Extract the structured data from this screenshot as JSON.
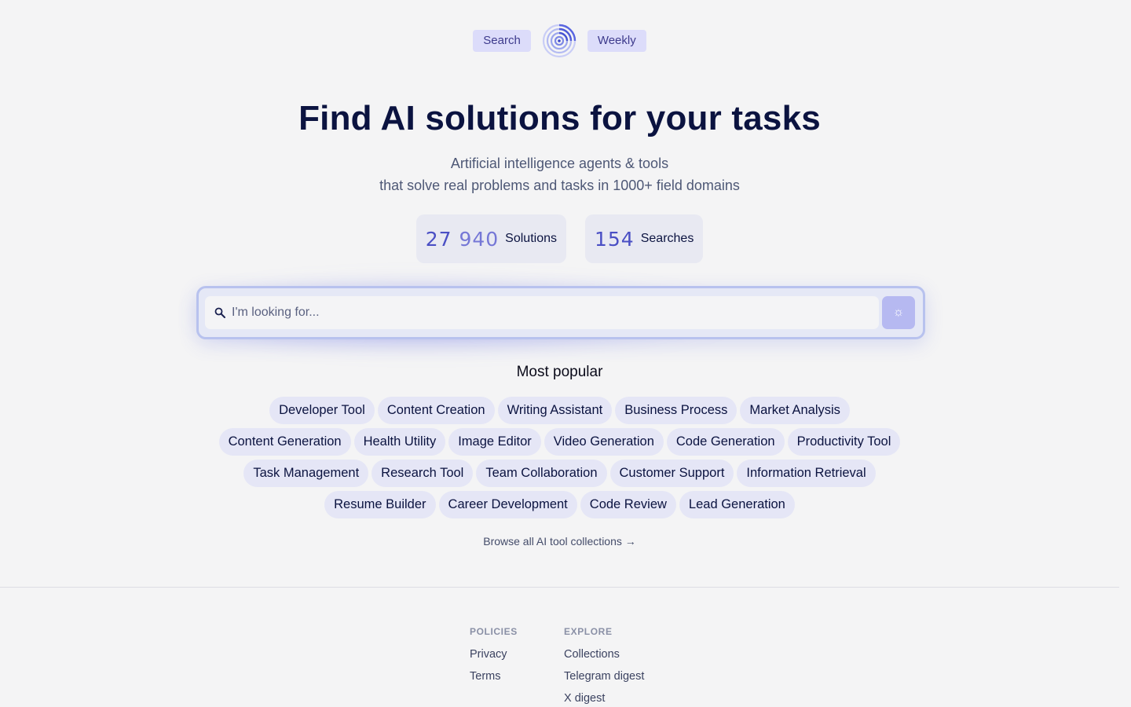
{
  "nav": {
    "left_label": "Search",
    "right_label": "Weekly",
    "logo_icon": "spiral-logo-icon"
  },
  "hero": {
    "title": "Find AI solutions for your tasks",
    "subtitle_line1": "Artificial intelligence agents & tools",
    "subtitle_line2": "that solve real problems and tasks in 1000+ field domains"
  },
  "stats": {
    "solutions_prefix": "27",
    "solutions_suffix": "940",
    "solutions_label": "Solutions",
    "searches_value": "154",
    "searches_label": "Searches"
  },
  "search": {
    "placeholder": "I'm looking for...",
    "value": "",
    "search_icon": "search-icon",
    "submit_icon": "sparkle-icon",
    "submit_glyph": "☼"
  },
  "popular": {
    "title": "Most popular",
    "tags": [
      "Developer Tool",
      "Content Creation",
      "Writing Assistant",
      "Business Process",
      "Market Analysis",
      "Content Generation",
      "Health Utility",
      "Image Editor",
      "Video Generation",
      "Code Generation",
      "Productivity Tool",
      "Task Management",
      "Research Tool",
      "Team Collaboration",
      "Customer Support",
      "Information Retrieval",
      "Resume Builder",
      "Career Development",
      "Code Review",
      "Lead Generation"
    ],
    "browse_label": "Browse all AI tool collections →"
  },
  "footer": {
    "policies_heading": "POLICIES",
    "policies_links": [
      "Privacy",
      "Terms"
    ],
    "explore_heading": "EXPLORE",
    "explore_links": [
      "Collections",
      "Telegram digest",
      "X digest"
    ]
  },
  "colors": {
    "accent": "#4a4fc4",
    "heading": "#0b1340",
    "tag_bg": "#e5e6f6",
    "nav_pill_bg": "#dcdcfa"
  }
}
